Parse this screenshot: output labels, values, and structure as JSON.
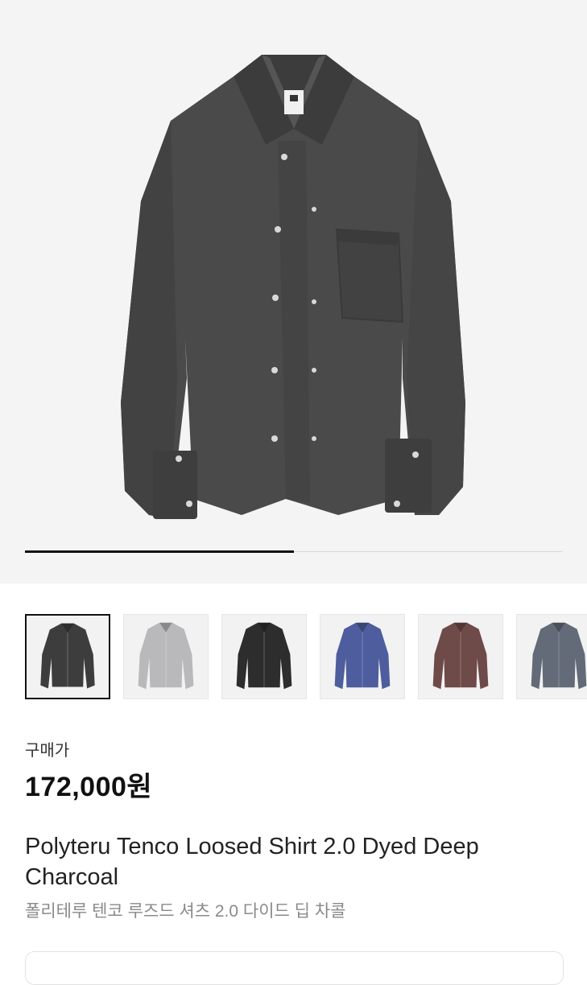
{
  "product": {
    "image_alt": "Polyteru Tenco Loosed Shirt 2.0 Dyed Deep Charcoal",
    "gallery_progress_fraction": 0.5,
    "colors": {
      "background": "#f4f4f4",
      "shirt_main": "#4a4a4a",
      "progress_fill": "#111111"
    },
    "thumbnails": [
      {
        "color_name": "deep-charcoal",
        "color": "#3d3d3d",
        "selected": true
      },
      {
        "color_name": "light-grey",
        "color": "#b9b9bb",
        "selected": false
      },
      {
        "color_name": "black",
        "color": "#2d2d2d",
        "selected": false
      },
      {
        "color_name": "blue",
        "color": "#4e5d9e",
        "selected": false
      },
      {
        "color_name": "brown",
        "color": "#6e4a49",
        "selected": false
      },
      {
        "color_name": "slate",
        "color": "#626b77",
        "selected": false
      }
    ],
    "price_label": "구매가",
    "price": "172,000원",
    "title_en": "Polyteru Tenco Loosed Shirt 2.0 Dyed Deep Charcoal",
    "title_ko": "폴리테루 텐코 루즈드 셔츠 2.0 다이드 딥 차콜"
  }
}
